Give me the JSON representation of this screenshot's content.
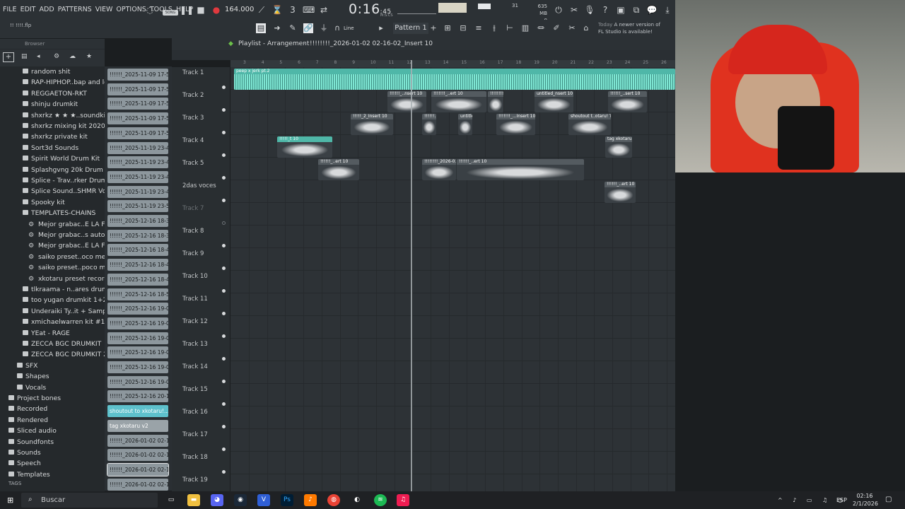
{
  "menu": [
    "FILE",
    "EDIT",
    "ADD",
    "PATTERNS",
    "VIEW",
    "OPTIONS",
    "TOOLS",
    "HELP"
  ],
  "transport": {
    "song_badge": "SONG",
    "tempo": "164.000",
    "time_main": "0:16",
    "time_small": ":45",
    "mcs": "M:S:CS",
    "cpu": "31",
    "mem": "635 MB",
    "mem2": "0"
  },
  "news": {
    "date": "Today",
    "text1": "A newer version of",
    "text2": "FL Studio is available!"
  },
  "project_file": "!! !!!!.flp",
  "pattern_label": "Pattern 1",
  "snap_label": "Line",
  "browser": {
    "title": "Browser",
    "items": [
      {
        "label": "random shit",
        "type": "folder"
      },
      {
        "label": "RAP-HIPHOP..bap and lofi",
        "type": "folder"
      },
      {
        "label": "REGGAETON-RKT",
        "type": "folder"
      },
      {
        "label": "shinju drumkit",
        "type": "folder"
      },
      {
        "label": "shxrkz ★ ★ ★..soundkit",
        "type": "folder"
      },
      {
        "label": "shxrkz mixing kit 2020",
        "type": "folder"
      },
      {
        "label": "shxrkz private kit",
        "type": "folder"
      },
      {
        "label": "Sort3d Sounds",
        "type": "folder"
      },
      {
        "label": "Spirit World Drum Kit",
        "type": "folder"
      },
      {
        "label": "Splashgvng 20k Drum Kit",
        "type": "folder"
      },
      {
        "label": "Splice - Trav..rker Drum Kit",
        "type": "folder"
      },
      {
        "label": "Splice Sound..SHMR Vol. 3",
        "type": "folder"
      },
      {
        "label": "Spooky kit",
        "type": "folder"
      },
      {
        "label": "TEMPLATES-CHAINS",
        "type": "folder"
      },
      {
        "label": "Mejor grabac..E LA FIESTA",
        "type": "preset"
      },
      {
        "label": "Mejor grabac..s autotune)",
        "type": "preset"
      },
      {
        "label": "Mejor grabac..E LA FIESTA",
        "type": "preset"
      },
      {
        "label": "saiko preset..oco mejor v2",
        "type": "preset"
      },
      {
        "label": "saiko preset..poco mejor",
        "type": "preset"
      },
      {
        "label": "xkotaru preset record",
        "type": "preset"
      },
      {
        "label": "tlkraama - n..ares drumkit",
        "type": "folder"
      },
      {
        "label": "too yugan drumkit 1+2",
        "type": "folder"
      },
      {
        "label": "Underaiki Ty..it + Samples",
        "type": "folder"
      },
      {
        "label": "xmichaelwarren kit #1",
        "type": "folder"
      },
      {
        "label": "YEat - RAGE",
        "type": "folder"
      },
      {
        "label": "ZECCA BGC DRUMKIT",
        "type": "folder"
      },
      {
        "label": "ZECCA BGC DRUMKIT 2",
        "type": "folder"
      },
      {
        "label": "SFX",
        "type": "folder"
      },
      {
        "label": "Shapes",
        "type": "folder"
      },
      {
        "label": "Vocals",
        "type": "folder"
      },
      {
        "label": "Project bones",
        "type": "root"
      },
      {
        "label": "Recorded",
        "type": "root"
      },
      {
        "label": "Rendered",
        "type": "root"
      },
      {
        "label": "Sliced audio",
        "type": "root"
      },
      {
        "label": "Soundfonts",
        "type": "root"
      },
      {
        "label": "Sounds",
        "type": "root"
      },
      {
        "label": "Speech",
        "type": "root"
      },
      {
        "label": "Templates",
        "type": "root"
      }
    ],
    "tags_label": "TAGS"
  },
  "clip_list": [
    "!!!!!!_2025-11-09 17-55...",
    "!!!!!!_2025-11-09 17-56...",
    "!!!!!!_2025-11-09 17-58...",
    "!!!!!!_2025-11-09 17-59...",
    "!!!!!!_2025-11-09 17-59...",
    "!!!!!!_2025-11-19 23-42...",
    "!!!!!!_2025-11-19 23-43...",
    "!!!!!!_2025-11-19 23-45...",
    "!!!!!!_2025-11-19 23-47...",
    "!!!!!!_2025-11-19 23-50...",
    "!!!!!!_2025-12-16 18-36...",
    "!!!!!!_2025-12-16 18-38...",
    "!!!!!!_2025-12-16 18-42...",
    "!!!!!!_2025-12-16 18-45...",
    "!!!!!!_2025-12-16 18-48...",
    "!!!!!!_2025-12-16 18-59...",
    "!!!!!!_2025-12-16 19-00...",
    "!!!!!!_2025-12-16 19-02...",
    "!!!!!!_2025-12-16 19-04...",
    "!!!!!!_2025-12-16 19-06...",
    "!!!!!!_2025-12-16 19-07...",
    "!!!!!!_2025-12-16 19-08...",
    "!!!!!!_2025-12-16 20-18...",
    "shoutout to xkotaru!...",
    "tag xkotaru v2",
    "!!!!!!_2026-01-02 02-13...",
    "!!!!!!_2026-01-02 02-14...",
    "!!!!!!_2026-01-02 02-15...",
    "!!!!!!_2026-01-02 02-16..."
  ],
  "playlist": {
    "title": "Playlist - Arrangement",
    "current": "!!!!!!!!_2026-01-02 02-16-02_Insert 10",
    "ruler": [
      "3",
      "4",
      "5",
      "6",
      "7",
      "8",
      "9",
      "10",
      "11",
      "12",
      "13",
      "14",
      "15",
      "16",
      "17",
      "18",
      "19",
      "20",
      "21",
      "22",
      "23",
      "24",
      "25",
      "26"
    ],
    "tracks": [
      "Track 1",
      "Track 2",
      "Track 3",
      "Track 4",
      "Track 5",
      "2das voces",
      "Track 7",
      "Track 8",
      "Track 9",
      "Track 10",
      "Track 11",
      "Track 12",
      "Track 13",
      "Track 14",
      "Track 15",
      "Track 16",
      "Track 17",
      "Track 18",
      "Track 19"
    ],
    "clips": [
      {
        "label": "peep x jerk pt.2"
      },
      {
        "label": "!!!!!!_..nsert 10"
      },
      {
        "label": "!!!!!!!_..ert 10"
      },
      {
        "label": "!!!!!!!!_..sert 10"
      },
      {
        "label": "untitled_nsert 10"
      },
      {
        "label": "!!!!!!_..sert 10"
      },
      {
        "label": "!!!!!_2_Insert 10"
      },
      {
        "label": "!!!!!!..."
      },
      {
        "label": "untitle...ert 10"
      },
      {
        "label": "!!!!!!!_...Insert 10"
      },
      {
        "label": "shoutout t..otaru! TAG"
      },
      {
        "label": "!!!!!_t 10"
      },
      {
        "label": "tag xkotaru v2"
      },
      {
        "label": "!!!!!!_..ert 10"
      },
      {
        "label": "!!!!!!!!_2026-01-02 02-16-02_Insert 10"
      },
      {
        "label": "!!!!!!_..ert 10"
      }
    ]
  },
  "taskbar": {
    "search": "Buscar",
    "lang": "ESP",
    "time": "02:16",
    "date": "2/1/2026"
  }
}
